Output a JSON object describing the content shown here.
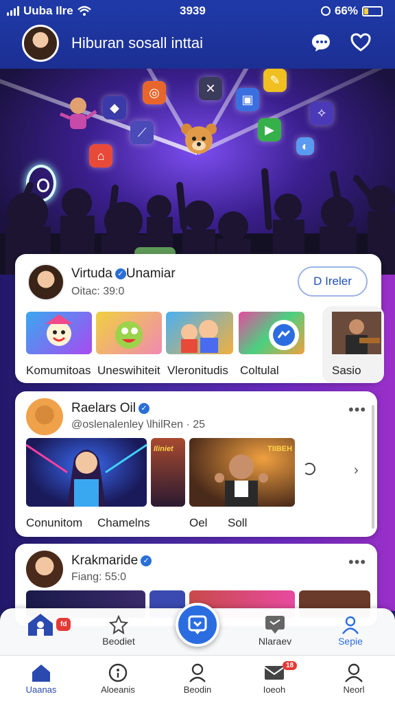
{
  "status": {
    "carrier": "Uuba Ilre",
    "time": "3939",
    "battery": "66%"
  },
  "header": {
    "title": "Hiburan sosall inttai"
  },
  "featured_card": {
    "name": "Virtuda",
    "name2": "Unamiar",
    "sub": "Oitac: 39:0",
    "follow_label": "D Ireler",
    "tiles": [
      {
        "label": "Komumitoas"
      },
      {
        "label": "Uneswihiteit"
      },
      {
        "label": "Vleronitudis"
      },
      {
        "label": "Coltulal"
      },
      {
        "label": "Sasio"
      }
    ]
  },
  "post1": {
    "name": "Raelars Oil",
    "sub": "@oslenalenley \\lhilRen · 25",
    "tile_labels": [
      "Conunitom",
      "Chamelns",
      "Oel",
      "Soll"
    ],
    "thumb_text_1": "Iliniet",
    "thumb_text_2": "TIIBEH"
  },
  "post2": {
    "name": "Krakmaride",
    "sub": "Fiang: 55:0"
  },
  "overlay_bar": [
    {
      "label": "",
      "icon": "home-person-icon"
    },
    {
      "label": "Beodiet",
      "icon": "star-outline-icon"
    },
    {
      "label": "Nlaraev",
      "icon": "chat-bubble-icon"
    },
    {
      "label": "Sepie",
      "icon": "person-icon"
    }
  ],
  "overlay_badge": "fd",
  "tabs": [
    {
      "label": "Uaanas",
      "icon": "home-icon"
    },
    {
      "label": "Aloeanis",
      "icon": "compass-icon"
    },
    {
      "label": "Beodin",
      "icon": "search-person-icon"
    },
    {
      "label": "Ioeoh",
      "icon": "mail-icon",
      "badge": "18"
    },
    {
      "label": "Neorl",
      "icon": "profile-icon"
    }
  ],
  "colors": {
    "primary": "#2b6de0",
    "header": "#1f3aa8",
    "badge": "#e53935"
  }
}
